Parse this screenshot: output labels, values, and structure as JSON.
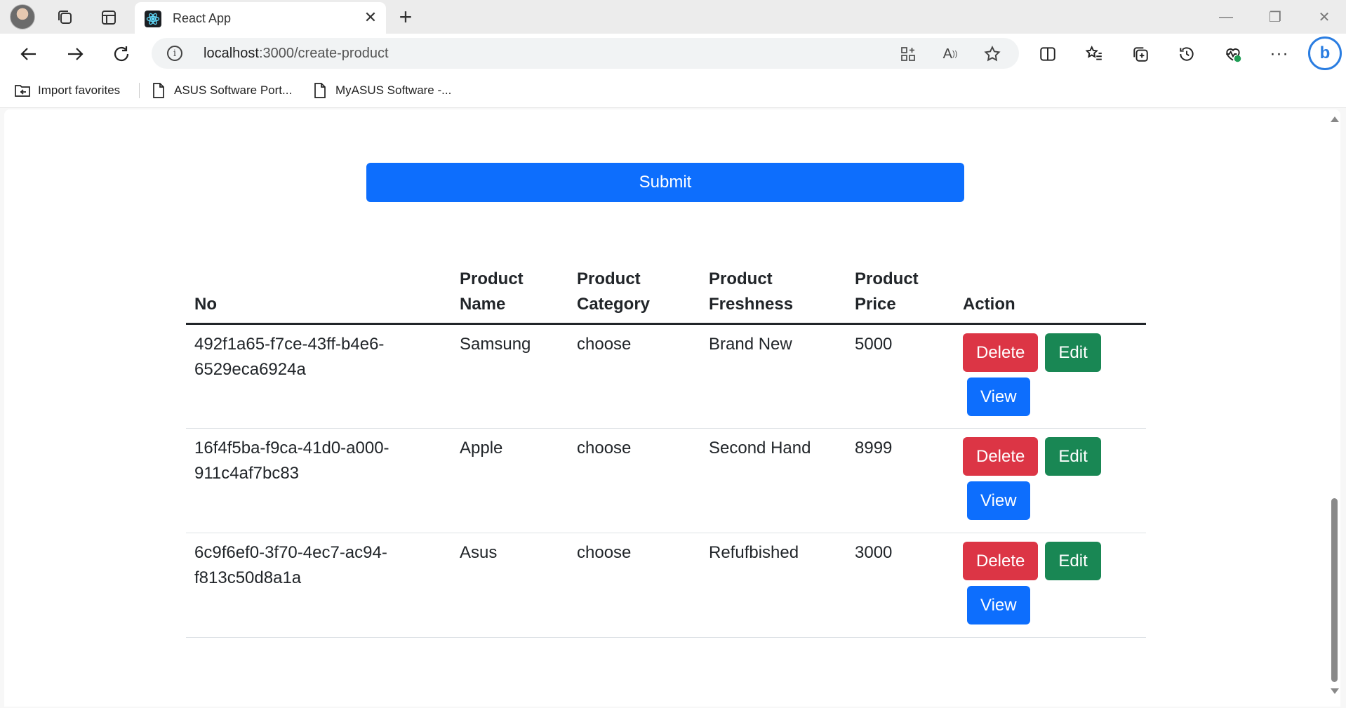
{
  "browser": {
    "tab_title": "React App",
    "url_host": "localhost",
    "url_path": ":3000/create-product",
    "favorites": [
      {
        "label": "Import favorites",
        "icon": "import-favorites-icon"
      },
      {
        "label": "ASUS Software Port...",
        "icon": "page-icon"
      },
      {
        "label": "MyASUS Software -...",
        "icon": "page-icon"
      }
    ]
  },
  "page": {
    "submit_label": "Submit",
    "table": {
      "headers": [
        "No",
        "Product Name",
        "Product Category",
        "Product Freshness",
        "Product Price",
        "Action"
      ],
      "rows": [
        {
          "id": "492f1a65-f7ce-43ff-b4e6-6529eca6924a",
          "name": "Samsung",
          "category": "choose",
          "freshness": "Brand New",
          "price": "5000"
        },
        {
          "id": "16f4f5ba-f9ca-41d0-a000-911c4af7bc83",
          "name": "Apple",
          "category": "choose",
          "freshness": "Second Hand",
          "price": "8999"
        },
        {
          "id": "6c9f6ef0-3f70-4ec7-ac94-f813c50d8a1a",
          "name": "Asus",
          "category": "choose",
          "freshness": "Refufbished",
          "price": "3000"
        }
      ],
      "actions": {
        "delete": "Delete",
        "edit": "Edit",
        "view": "View"
      }
    }
  },
  "colors": {
    "primary": "#0d6efd",
    "danger": "#dc3545",
    "success": "#198754"
  }
}
